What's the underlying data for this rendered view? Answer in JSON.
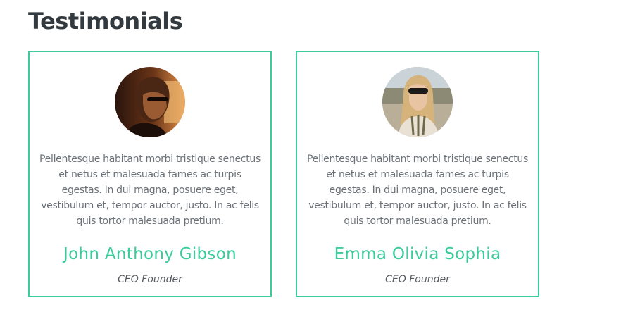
{
  "section": {
    "title": "Testimonials"
  },
  "testimonials": [
    {
      "avatar_icon": "man-portrait-photo",
      "quote": "Pellentesque habitant morbi tristique senectus et netus et malesuada fames ac turpis egestas. In dui magna, posuere eget, vestibulum et, tempor auctor, justo. In ac felis quis tortor malesuada pretium.",
      "name": "John Anthony Gibson",
      "role": "CEO Founder"
    },
    {
      "avatar_icon": "woman-portrait-photo",
      "quote": "Pellentesque habitant morbi tristique senectus et netus et malesuada fames ac turpis egestas. In dui magna, posuere eget, vestibulum et, tempor auctor, justo. In ac felis quis tortor malesuada pretium.",
      "name": "Emma Olivia Sophia",
      "role": "CEO Founder"
    }
  ],
  "colors": {
    "accent": "#3ccb9b",
    "heading": "#333a3f",
    "body_text": "#6b7177",
    "role_text": "#55595e"
  }
}
